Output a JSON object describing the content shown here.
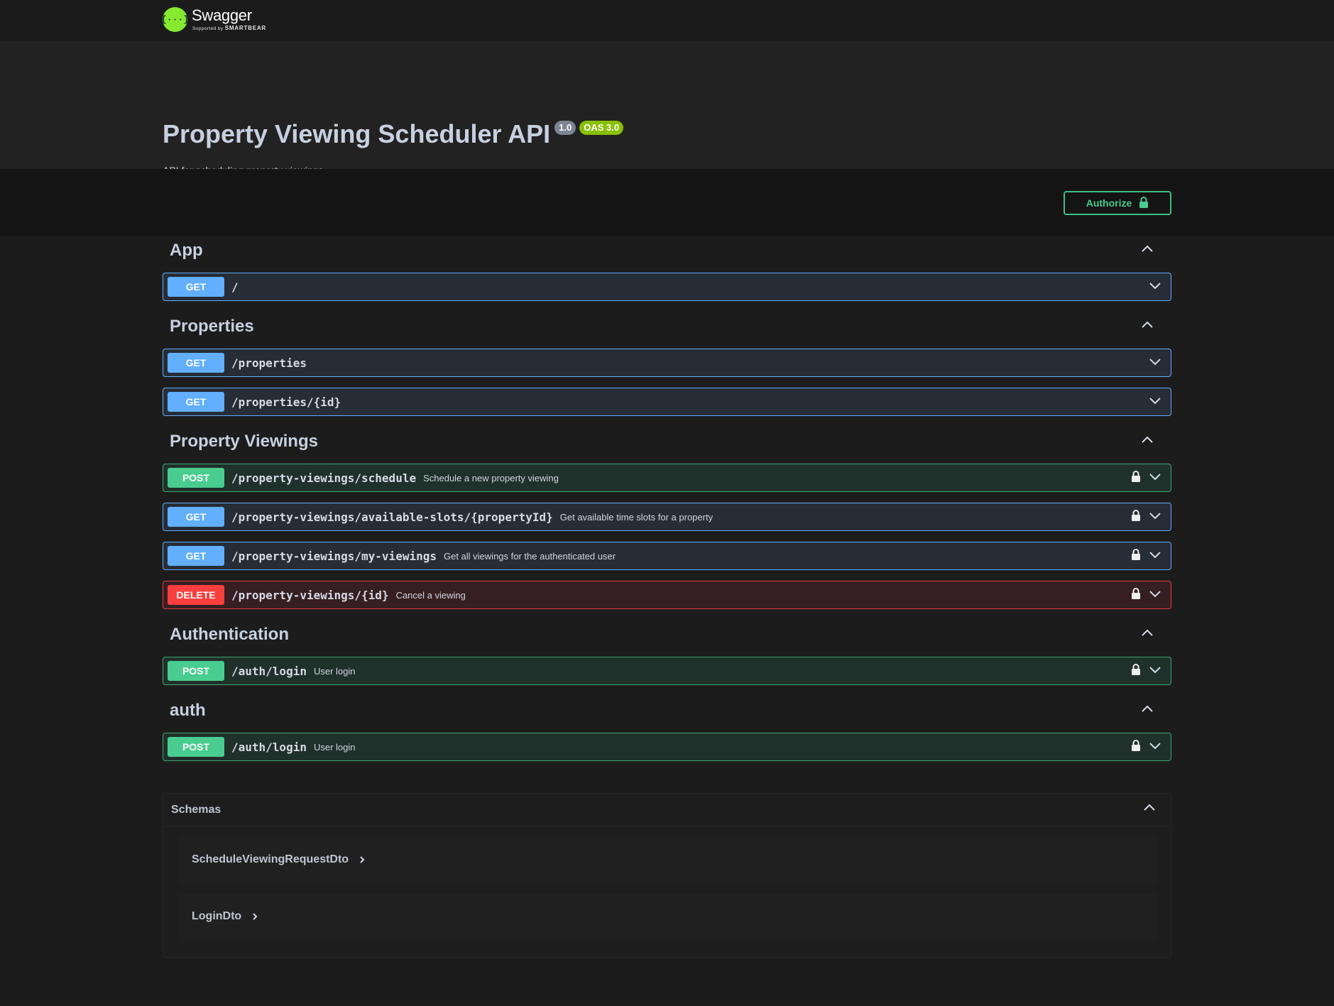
{
  "header": {
    "logo_text": "Swagger",
    "logo_sub_prefix": "Supported by",
    "logo_sub_brand": "SMARTBEAR",
    "logo_glyph": "{···}"
  },
  "info": {
    "title": "Property Viewing Scheduler API",
    "version": "1.0",
    "oas": "OAS 3.0",
    "description": "API for scheduling property viewings"
  },
  "authorize": {
    "label": "Authorize",
    "icon": "lock-icon"
  },
  "colors": {
    "get": "#61affe",
    "post": "#49cc90",
    "delete": "#f93e3e",
    "accent": "#85ea2d"
  },
  "tags": [
    {
      "name": "App",
      "operations": [
        {
          "method": "GET",
          "path": "/",
          "summary": "",
          "locked": false
        }
      ]
    },
    {
      "name": "Properties",
      "operations": [
        {
          "method": "GET",
          "path": "/properties",
          "summary": "",
          "locked": false
        },
        {
          "method": "GET",
          "path": "/properties/{id}",
          "summary": "",
          "locked": false
        }
      ]
    },
    {
      "name": "Property Viewings",
      "operations": [
        {
          "method": "POST",
          "path": "/property-viewings/schedule",
          "summary": "Schedule a new property viewing",
          "locked": true
        },
        {
          "method": "GET",
          "path": "/property-viewings/available-slots/{propertyId}",
          "summary": "Get available time slots for a property",
          "locked": true
        },
        {
          "method": "GET",
          "path": "/property-viewings/my-viewings",
          "summary": "Get all viewings for the authenticated user",
          "locked": true
        },
        {
          "method": "DELETE",
          "path": "/property-viewings/{id}",
          "summary": "Cancel a viewing",
          "locked": true
        }
      ]
    },
    {
      "name": "Authentication",
      "operations": [
        {
          "method": "POST",
          "path": "/auth/login",
          "summary": "User login",
          "locked": true
        }
      ]
    },
    {
      "name": "auth",
      "operations": [
        {
          "method": "POST",
          "path": "/auth/login",
          "summary": "User login",
          "locked": true
        }
      ]
    }
  ],
  "schemas": {
    "title": "Schemas",
    "models": [
      "ScheduleViewingRequestDto",
      "LoginDto"
    ]
  }
}
